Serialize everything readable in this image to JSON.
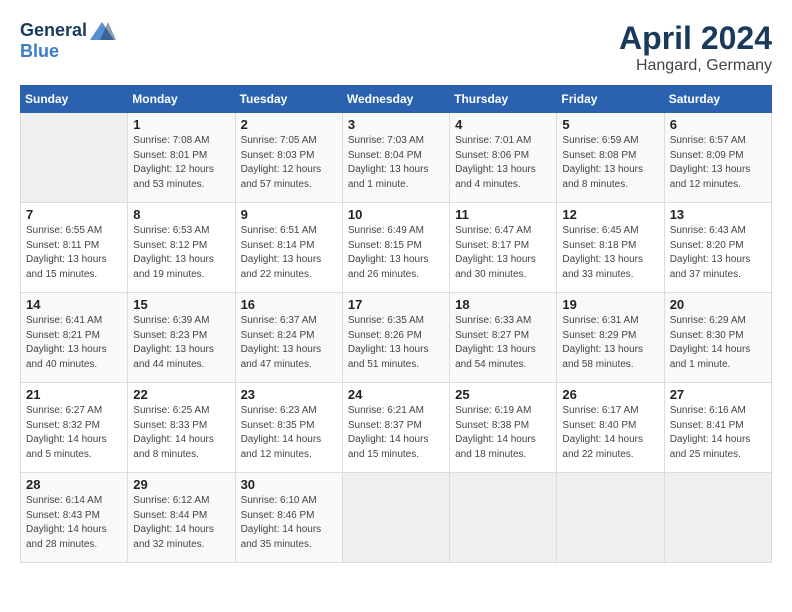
{
  "header": {
    "logo_line1": "General",
    "logo_line2": "Blue",
    "month_title": "April 2024",
    "location": "Hangard, Germany"
  },
  "days_of_week": [
    "Sunday",
    "Monday",
    "Tuesday",
    "Wednesday",
    "Thursday",
    "Friday",
    "Saturday"
  ],
  "weeks": [
    [
      {
        "day": "",
        "info": ""
      },
      {
        "day": "1",
        "info": "Sunrise: 7:08 AM\nSunset: 8:01 PM\nDaylight: 12 hours\nand 53 minutes."
      },
      {
        "day": "2",
        "info": "Sunrise: 7:05 AM\nSunset: 8:03 PM\nDaylight: 12 hours\nand 57 minutes."
      },
      {
        "day": "3",
        "info": "Sunrise: 7:03 AM\nSunset: 8:04 PM\nDaylight: 13 hours\nand 1 minute."
      },
      {
        "day": "4",
        "info": "Sunrise: 7:01 AM\nSunset: 8:06 PM\nDaylight: 13 hours\nand 4 minutes."
      },
      {
        "day": "5",
        "info": "Sunrise: 6:59 AM\nSunset: 8:08 PM\nDaylight: 13 hours\nand 8 minutes."
      },
      {
        "day": "6",
        "info": "Sunrise: 6:57 AM\nSunset: 8:09 PM\nDaylight: 13 hours\nand 12 minutes."
      }
    ],
    [
      {
        "day": "7",
        "info": "Sunrise: 6:55 AM\nSunset: 8:11 PM\nDaylight: 13 hours\nand 15 minutes."
      },
      {
        "day": "8",
        "info": "Sunrise: 6:53 AM\nSunset: 8:12 PM\nDaylight: 13 hours\nand 19 minutes."
      },
      {
        "day": "9",
        "info": "Sunrise: 6:51 AM\nSunset: 8:14 PM\nDaylight: 13 hours\nand 22 minutes."
      },
      {
        "day": "10",
        "info": "Sunrise: 6:49 AM\nSunset: 8:15 PM\nDaylight: 13 hours\nand 26 minutes."
      },
      {
        "day": "11",
        "info": "Sunrise: 6:47 AM\nSunset: 8:17 PM\nDaylight: 13 hours\nand 30 minutes."
      },
      {
        "day": "12",
        "info": "Sunrise: 6:45 AM\nSunset: 8:18 PM\nDaylight: 13 hours\nand 33 minutes."
      },
      {
        "day": "13",
        "info": "Sunrise: 6:43 AM\nSunset: 8:20 PM\nDaylight: 13 hours\nand 37 minutes."
      }
    ],
    [
      {
        "day": "14",
        "info": "Sunrise: 6:41 AM\nSunset: 8:21 PM\nDaylight: 13 hours\nand 40 minutes."
      },
      {
        "day": "15",
        "info": "Sunrise: 6:39 AM\nSunset: 8:23 PM\nDaylight: 13 hours\nand 44 minutes."
      },
      {
        "day": "16",
        "info": "Sunrise: 6:37 AM\nSunset: 8:24 PM\nDaylight: 13 hours\nand 47 minutes."
      },
      {
        "day": "17",
        "info": "Sunrise: 6:35 AM\nSunset: 8:26 PM\nDaylight: 13 hours\nand 51 minutes."
      },
      {
        "day": "18",
        "info": "Sunrise: 6:33 AM\nSunset: 8:27 PM\nDaylight: 13 hours\nand 54 minutes."
      },
      {
        "day": "19",
        "info": "Sunrise: 6:31 AM\nSunset: 8:29 PM\nDaylight: 13 hours\nand 58 minutes."
      },
      {
        "day": "20",
        "info": "Sunrise: 6:29 AM\nSunset: 8:30 PM\nDaylight: 14 hours\nand 1 minute."
      }
    ],
    [
      {
        "day": "21",
        "info": "Sunrise: 6:27 AM\nSunset: 8:32 PM\nDaylight: 14 hours\nand 5 minutes."
      },
      {
        "day": "22",
        "info": "Sunrise: 6:25 AM\nSunset: 8:33 PM\nDaylight: 14 hours\nand 8 minutes."
      },
      {
        "day": "23",
        "info": "Sunrise: 6:23 AM\nSunset: 8:35 PM\nDaylight: 14 hours\nand 12 minutes."
      },
      {
        "day": "24",
        "info": "Sunrise: 6:21 AM\nSunset: 8:37 PM\nDaylight: 14 hours\nand 15 minutes."
      },
      {
        "day": "25",
        "info": "Sunrise: 6:19 AM\nSunset: 8:38 PM\nDaylight: 14 hours\nand 18 minutes."
      },
      {
        "day": "26",
        "info": "Sunrise: 6:17 AM\nSunset: 8:40 PM\nDaylight: 14 hours\nand 22 minutes."
      },
      {
        "day": "27",
        "info": "Sunrise: 6:16 AM\nSunset: 8:41 PM\nDaylight: 14 hours\nand 25 minutes."
      }
    ],
    [
      {
        "day": "28",
        "info": "Sunrise: 6:14 AM\nSunset: 8:43 PM\nDaylight: 14 hours\nand 28 minutes."
      },
      {
        "day": "29",
        "info": "Sunrise: 6:12 AM\nSunset: 8:44 PM\nDaylight: 14 hours\nand 32 minutes."
      },
      {
        "day": "30",
        "info": "Sunrise: 6:10 AM\nSunset: 8:46 PM\nDaylight: 14 hours\nand 35 minutes."
      },
      {
        "day": "",
        "info": ""
      },
      {
        "day": "",
        "info": ""
      },
      {
        "day": "",
        "info": ""
      },
      {
        "day": "",
        "info": ""
      }
    ]
  ]
}
